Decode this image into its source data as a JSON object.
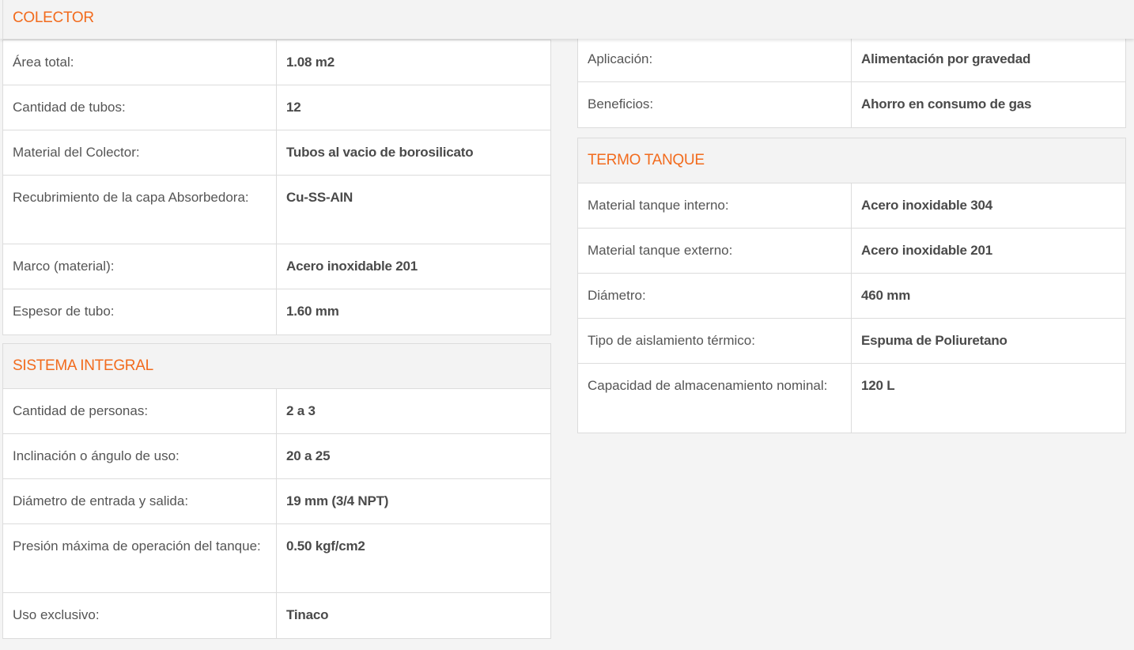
{
  "colector": {
    "title": "COLECTOR",
    "rows": [
      {
        "label": "Área total:",
        "value": "1.08 m2"
      },
      {
        "label": "Cantidad de tubos:",
        "value": "12"
      },
      {
        "label": "Material del Colector:",
        "value": "Tubos al vacio de borosilicato"
      },
      {
        "label": "Recubrimiento de la capa Absorbedora:",
        "value": "Cu-SS-AIN"
      },
      {
        "label": "Marco (material):",
        "value": "Acero inoxidable 201"
      },
      {
        "label": "Espesor de tubo:",
        "value": "1.60 mm"
      }
    ]
  },
  "sistema": {
    "title": "SISTEMA INTEGRAL",
    "rows": [
      {
        "label": "Cantidad de personas:",
        "value": "2 a 3"
      },
      {
        "label": "Inclinación o ángulo de uso:",
        "value": "20 a 25"
      },
      {
        "label": "Diámetro de entrada y salida:",
        "value": "19 mm (3/4 NPT)"
      },
      {
        "label": "Presión máxima de operación del tanque:",
        "value": "0.50 kgf/cm2"
      },
      {
        "label": "Uso exclusivo:",
        "value": "Tinaco"
      }
    ]
  },
  "general": {
    "rows": [
      {
        "label": "Aplicación:",
        "value": "Alimentación por gravedad"
      },
      {
        "label": "Beneficios:",
        "value": "Ahorro en consumo de gas"
      }
    ]
  },
  "termo": {
    "title": "TERMO TANQUE",
    "rows": [
      {
        "label": "Material tanque interno:",
        "value": "Acero inoxidable 304"
      },
      {
        "label": "Material tanque externo:",
        "value": "Acero inoxidable 201"
      },
      {
        "label": "Diámetro:",
        "value": "460 mm"
      },
      {
        "label": "Tipo de aislamiento térmico:",
        "value": "Espuma de Poliuretano"
      },
      {
        "label": "Capacidad de almacenamiento nominal:",
        "value": "120 L"
      }
    ]
  },
  "colors": {
    "accent": "#f26b1d",
    "header_bg": "#f3f3f3",
    "border": "#dcdcdc"
  }
}
